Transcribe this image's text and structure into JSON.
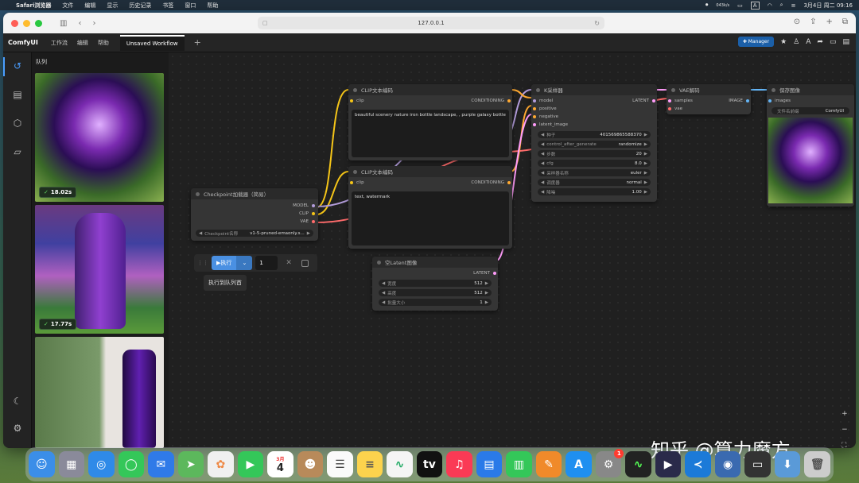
{
  "menubar": {
    "app": "Safari浏览器",
    "items": [
      "文件",
      "编辑",
      "显示",
      "历史记录",
      "书签",
      "窗口",
      "帮助"
    ],
    "net_speed": "043k/s",
    "input_method": "A",
    "datetime": "3月4日 周二 09:16"
  },
  "browser": {
    "url": "127.0.0.1"
  },
  "app": {
    "logo": "ComfyUI",
    "menus": [
      "工作流",
      "编辑",
      "帮助"
    ],
    "tab": "Unsaved Workflow",
    "add_tab": "+",
    "manager_label": "Manager"
  },
  "queue": {
    "title": "队列",
    "items": [
      {
        "time": "18.02s"
      },
      {
        "time": "17.77s"
      }
    ]
  },
  "nodes": {
    "checkpoint": {
      "title": "Checkpoint加载器（简易）",
      "outputs": [
        "MODEL",
        "CLIP",
        "VAE"
      ],
      "widget_label": "Checkpoint名称",
      "widget_value": "v1-5-pruned-emaonly.s..."
    },
    "clip_pos": {
      "title": "CLIP文本编码",
      "input": "clip",
      "output": "CONDITIONING",
      "text": "beautiful scenery nature iron bottle landscape, , purple galaxy bottle"
    },
    "clip_neg": {
      "title": "CLIP文本编码",
      "input": "clip",
      "output": "CONDITIONING",
      "text": "text, watermark"
    },
    "ksampler": {
      "title": "K采样器",
      "inputs": [
        "model",
        "positive",
        "negative",
        "latent_image"
      ],
      "output": "LATENT",
      "widgets": [
        {
          "label": "种子",
          "value": "401569865588370"
        },
        {
          "label": "control_after_generate",
          "value": "randomize"
        },
        {
          "label": "步数",
          "value": "20"
        },
        {
          "label": "cfg",
          "value": "8.0"
        },
        {
          "label": "采样器名称",
          "value": "euler"
        },
        {
          "label": "调度器",
          "value": "normal"
        },
        {
          "label": "降噪",
          "value": "1.00"
        }
      ]
    },
    "vae_decode": {
      "title": "VAE解码",
      "inputs": [
        "samples",
        "vae"
      ],
      "output": "IMAGE"
    },
    "save_image": {
      "title": "保存图像",
      "input": "images",
      "widget_label": "文件名前缀",
      "widget_value": "ComfyUI"
    },
    "empty_latent": {
      "title": "空Latent图像",
      "output": "LATENT",
      "widgets": [
        {
          "label": "宽度",
          "value": "512"
        },
        {
          "label": "高度",
          "value": "512"
        },
        {
          "label": "批量大小",
          "value": "1"
        }
      ]
    }
  },
  "runbar": {
    "run_label": "执行",
    "count": "1",
    "tooltip": "执行到队列首"
  },
  "watermark": "知乎 @算力魔方",
  "dock": {
    "calendar_month": "3月",
    "calendar_day": "4",
    "appstore_badge": "1"
  },
  "colors": {
    "accent": "#4a90e2",
    "manager": "#1b5fa8",
    "wire_model": "#b39ddb",
    "wire_clip": "#f5c518",
    "wire_vae": "#ff6b6b",
    "wire_conditioning": "#ffa931",
    "wire_latent": "#ff9cf9",
    "wire_image": "#64b5f6"
  }
}
